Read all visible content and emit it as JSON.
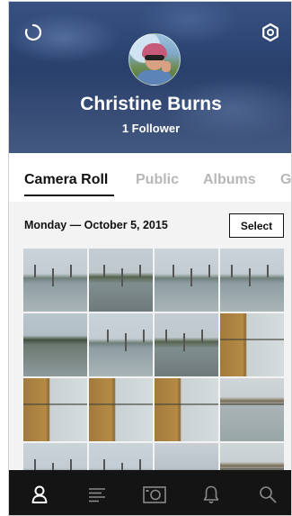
{
  "header": {
    "user_name": "Christine Burns",
    "followers": "1 Follower",
    "icons": {
      "left": "refresh-icon",
      "right": "settings-gear-icon"
    }
  },
  "tabs": [
    {
      "label": "Camera Roll",
      "active": true
    },
    {
      "label": "Public",
      "active": false
    },
    {
      "label": "Albums",
      "active": false
    },
    {
      "label": "G",
      "active": false
    }
  ],
  "section": {
    "date": "Monday — October 5, 2015",
    "select_label": "Select"
  },
  "photos": [
    {
      "kind": "water"
    },
    {
      "kind": "dock"
    },
    {
      "kind": "water"
    },
    {
      "kind": "water"
    },
    {
      "kind": "flood"
    },
    {
      "kind": "water"
    },
    {
      "kind": "dock"
    },
    {
      "kind": "wood"
    },
    {
      "kind": "wood"
    },
    {
      "kind": "wood"
    },
    {
      "kind": "wood"
    },
    {
      "kind": "rail"
    },
    {
      "kind": "water"
    },
    {
      "kind": "water"
    },
    {
      "kind": "dark"
    },
    {
      "kind": "rail"
    }
  ],
  "bottom_nav": [
    {
      "name": "profile-icon",
      "active": true
    },
    {
      "name": "feed-icon",
      "active": false
    },
    {
      "name": "camera-icon",
      "active": false
    },
    {
      "name": "notifications-bell-icon",
      "active": false
    },
    {
      "name": "search-icon",
      "active": false
    }
  ],
  "colors": {
    "active": "#ffffff",
    "inactive": "#8a8a8a",
    "nav_bg": "#141414"
  }
}
